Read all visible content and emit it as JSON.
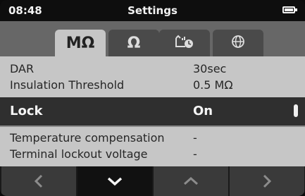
{
  "status_bar": {
    "time": "08:48",
    "title": "Settings",
    "battery_icon": "battery-full-icon"
  },
  "tabs": [
    {
      "label": "MΩ",
      "icon": "megaohm-icon",
      "active": true
    },
    {
      "label": "Ω",
      "icon": "ohm-icon",
      "active": false
    },
    {
      "label": "",
      "icon": "tools-clock-icon",
      "active": false
    },
    {
      "label": "",
      "icon": "globe-icon",
      "active": false
    }
  ],
  "settings": {
    "dar": {
      "label": "DAR",
      "value": "30sec"
    },
    "insulation_threshold": {
      "label": "Insulation Threshold",
      "value": "0.5 MΩ"
    },
    "lock": {
      "label": "Lock",
      "value": "On"
    },
    "temperature_compensation": {
      "label": "Temperature compensation",
      "value": "-"
    },
    "terminal_lockout_voltage": {
      "label": "Terminal lockout voltage",
      "value": "-"
    }
  },
  "nav_buttons": [
    {
      "icon": "chevron-left-icon"
    },
    {
      "icon": "chevron-down-icon",
      "active": true
    },
    {
      "icon": "chevron-up-icon"
    },
    {
      "icon": "chevron-right-icon"
    }
  ],
  "colors": {
    "selected_row": "#2f2f2f",
    "list_background": "#c6c6c6",
    "tab_bar": "#676767"
  }
}
